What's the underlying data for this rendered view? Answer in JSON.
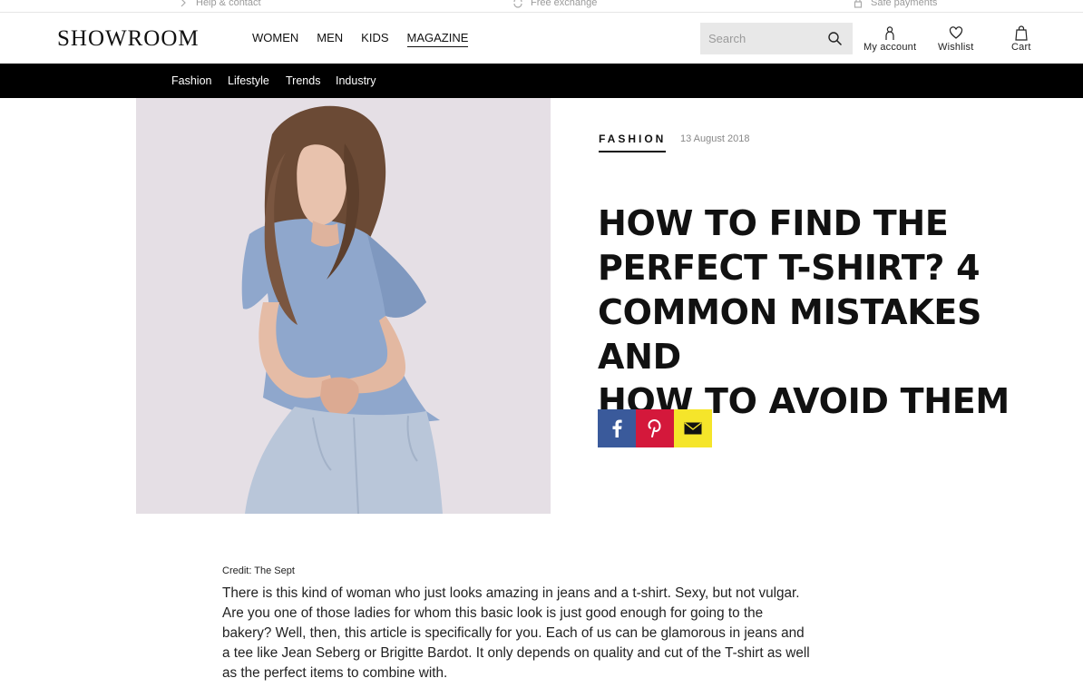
{
  "utility": {
    "help": "Help & contact",
    "exchange": "Free exchange",
    "payments": "Safe payments"
  },
  "header": {
    "logo": "SHOWROOM",
    "nav": [
      "WOMEN",
      "MEN",
      "KIDS",
      "MAGAZINE"
    ],
    "active_nav": "MAGAZINE",
    "search_placeholder": "Search",
    "account_label": "My account",
    "wishlist_label": "Wishlist",
    "cart_label": "Cart"
  },
  "category_bar": {
    "items": [
      "Fashion",
      "Lifestyle",
      "Trends",
      "Industry"
    ]
  },
  "article": {
    "category": "FASHION",
    "date": "13 August 2018",
    "title_lines": [
      "HOW TO FIND THE",
      "PERFECT T-SHIRT? 4",
      "COMMON MISTAKES AND",
      "HOW TO AVOID THEM"
    ],
    "share": [
      "facebook-icon",
      "pinterest-icon",
      "mail-icon"
    ],
    "credit": "Credit: The Sept",
    "body_lines": [
      "There is this kind of woman who just looks amazing in jeans and a t-shirt. Sexy, but not vulgar.",
      "Are you one of those ladies for whom this basic look is just good enough for going to the",
      "bakery? Well, then, this article is specifically  for you. Each of us can be glamorous in jeans and",
      "a tee like Jean Seberg or Brigitte Bardot. It only depends on quality and cut of the T-shirt as well",
      "as the perfect items to combine with."
    ]
  },
  "colors": {
    "category_bar": "#000000",
    "facebook": "#3a5a9b",
    "pinterest": "#d4183b",
    "mail": "#f5e52a",
    "search_bg": "#e8e8e8"
  }
}
